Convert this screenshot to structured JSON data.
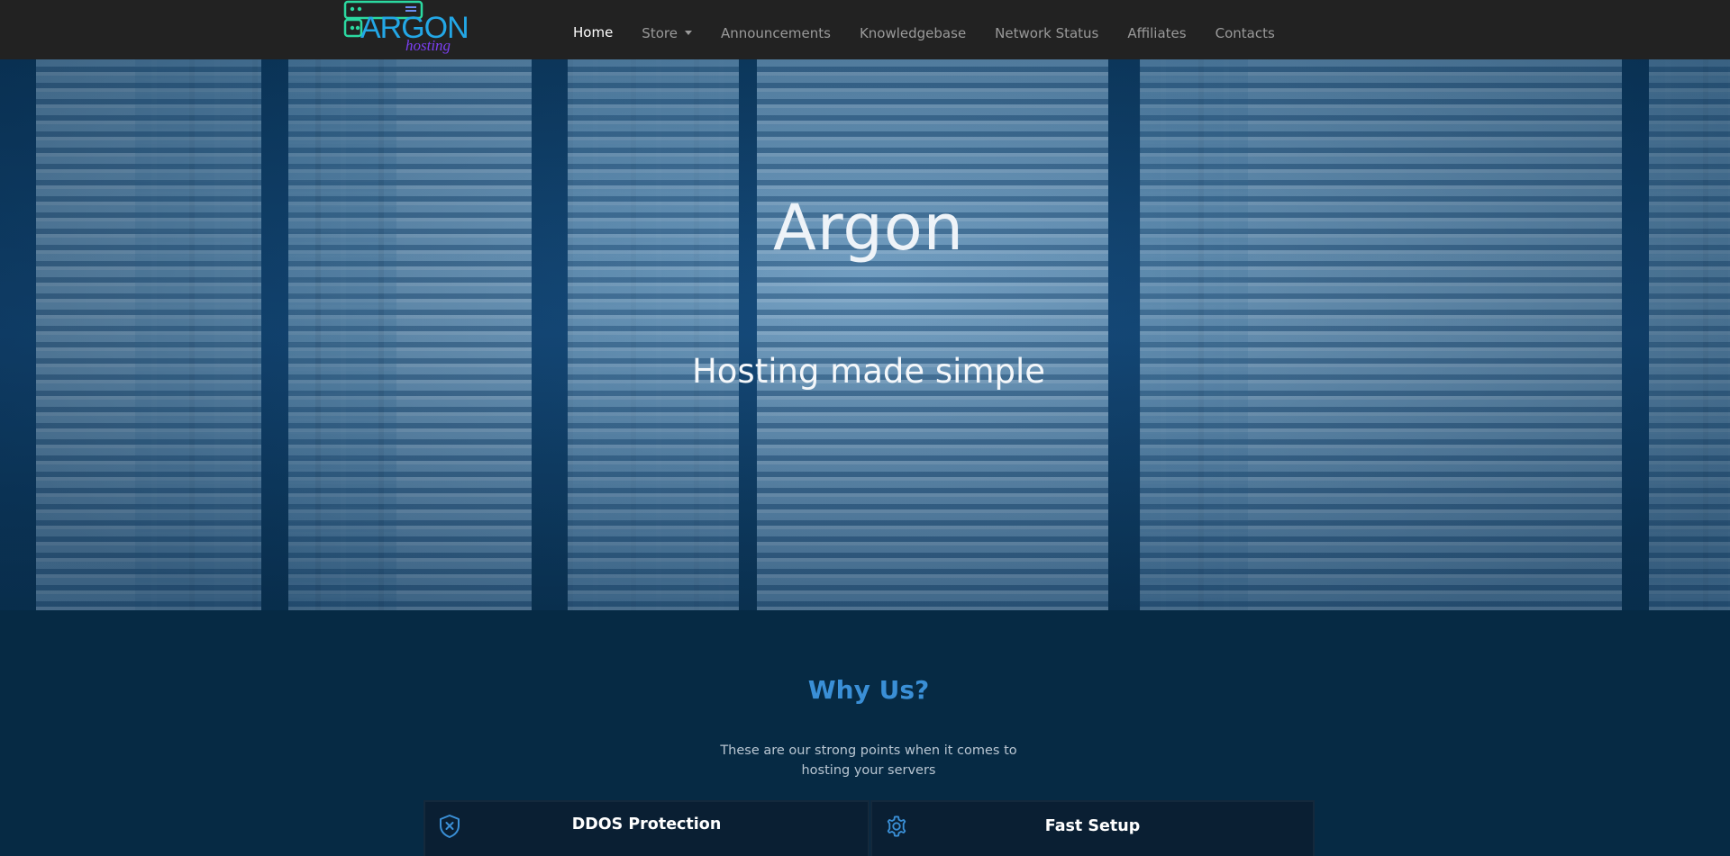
{
  "brand": {
    "logo_text": "ARGON",
    "logo_subtext": "hosting",
    "colors": {
      "logo_green": "#2bd9a0",
      "logo_blue": "#23a7e6",
      "logo_purple": "#7b3ff2"
    }
  },
  "nav": {
    "items": [
      {
        "label": "Home",
        "active": true
      },
      {
        "label": "Store",
        "dropdown": true
      },
      {
        "label": "Announcements"
      },
      {
        "label": "Knowledgebase"
      },
      {
        "label": "Network Status"
      },
      {
        "label": "Affiliates"
      },
      {
        "label": "Contacts"
      }
    ]
  },
  "hero": {
    "title": "Argon",
    "subtitle": "Hosting made simple",
    "background": "server-racks-image"
  },
  "why_us": {
    "title": "Why Us?",
    "description": "These are our strong points when it comes to hosting your servers",
    "accent": "#3a8fd6",
    "features": [
      {
        "label": "DDOS Protection",
        "icon": "shield-x-icon"
      },
      {
        "label": "Fast Setup",
        "icon": "gear-icon"
      }
    ]
  }
}
